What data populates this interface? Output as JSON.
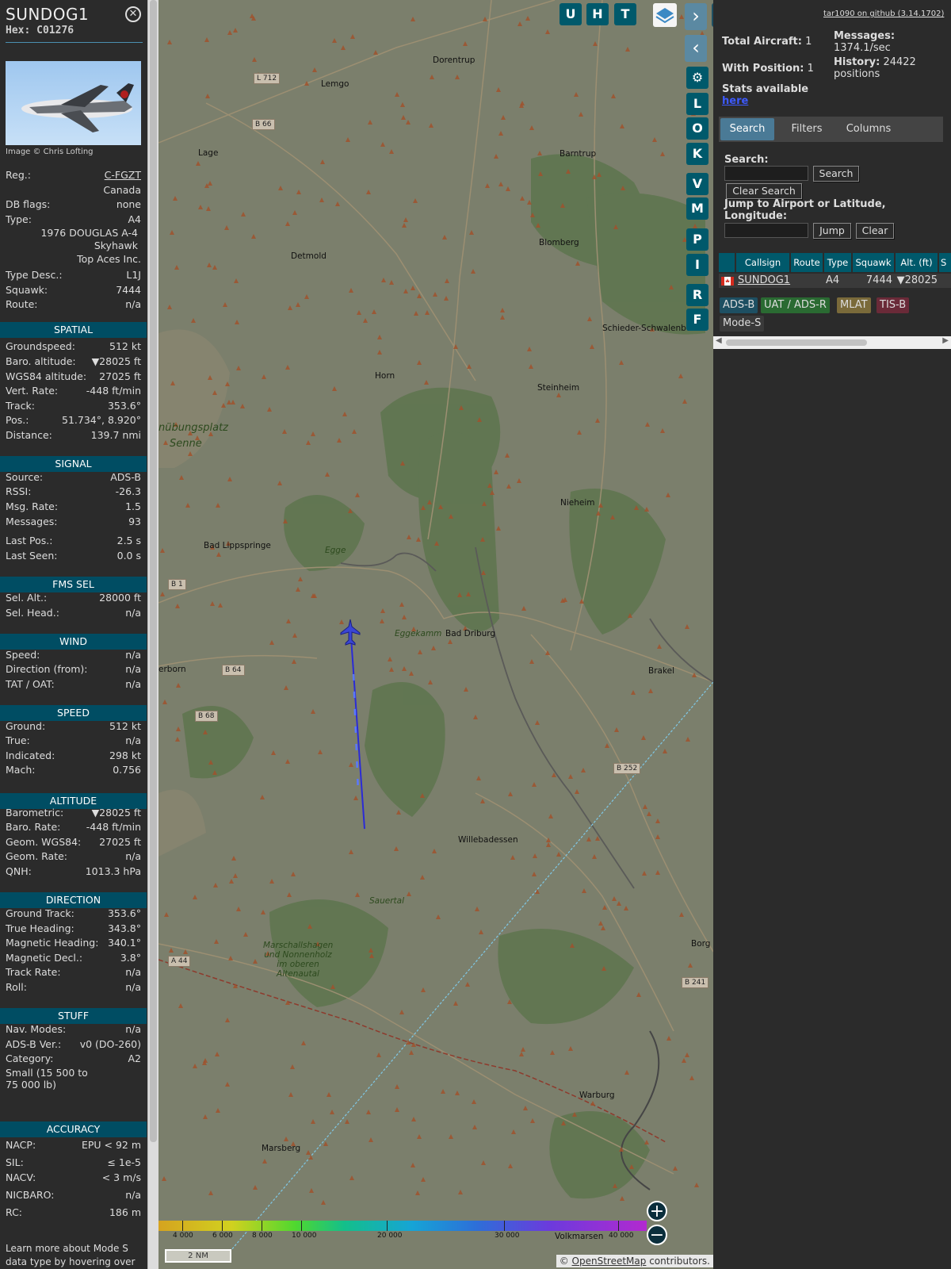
{
  "info": {
    "callsign": "SUNDOG1",
    "hex": "Hex: C01276",
    "close_glyph": "ⓧ",
    "image_credit": "Image © Chris Lofting",
    "rows": [
      {
        "k": "Reg.:",
        "v": "C-FGZT"
      },
      {
        "k": "",
        "v": "Canada"
      },
      {
        "k": "DB flags:",
        "v": "none"
      },
      {
        "k": "Type:",
        "v": "A4"
      }
    ],
    "type_long": "1976 DOUGLAS A-4 Skyhawk",
    "operator": "Top Aces Inc.",
    "rows2": [
      {
        "k": "Type Desc.:",
        "v": "L1J"
      },
      {
        "k": "Squawk:",
        "v": "7444"
      },
      {
        "k": "Route:",
        "v": "n/a"
      }
    ],
    "sections": {
      "spatial": "SPATIAL",
      "signal": "SIGNAL",
      "fms": "FMS SEL",
      "wind": "WIND",
      "speed": "SPEED",
      "altitude": "ALTITUDE",
      "direction": "DIRECTION",
      "stuff": "STUFF",
      "accuracy": "ACCURACY"
    },
    "spatial": [
      {
        "k": "Groundspeed:",
        "v": "512 kt"
      },
      {
        "k": "Baro. altitude:",
        "v": "▼28025 ft"
      },
      {
        "k": "WGS84 altitude:",
        "v": "27025 ft"
      },
      {
        "k": "Vert. Rate:",
        "v": "-448 ft/min"
      },
      {
        "k": "Track:",
        "v": "353.6°"
      },
      {
        "k": "Pos.:",
        "v": "51.734°, 8.920°"
      },
      {
        "k": "Distance:",
        "v": "139.7 nmi"
      }
    ],
    "signal": [
      {
        "k": "Source:",
        "v": "ADS-B"
      },
      {
        "k": "RSSI:",
        "v": "-26.3"
      },
      {
        "k": "Msg. Rate:",
        "v": "1.5"
      },
      {
        "k": "Messages:",
        "v": "93"
      },
      {
        "k": "Last Pos.:",
        "v": "2.5 s"
      },
      {
        "k": "Last Seen:",
        "v": "0.0 s"
      }
    ],
    "fms": [
      {
        "k": "Sel. Alt.:",
        "v": "28000 ft"
      },
      {
        "k": "Sel. Head.:",
        "v": "n/a"
      }
    ],
    "wind": [
      {
        "k": "Speed:",
        "v": "n/a"
      },
      {
        "k": "Direction (from):",
        "v": "n/a"
      },
      {
        "k": "TAT / OAT:",
        "v": "n/a"
      }
    ],
    "speed": [
      {
        "k": "Ground:",
        "v": "512 kt"
      },
      {
        "k": "True:",
        "v": "n/a"
      },
      {
        "k": "Indicated:",
        "v": "298 kt"
      },
      {
        "k": "Mach:",
        "v": "0.756"
      }
    ],
    "altitude": [
      {
        "k": "Barometric:",
        "v": "▼28025 ft"
      },
      {
        "k": "Baro. Rate:",
        "v": "-448 ft/min"
      },
      {
        "k": "Geom. WGS84:",
        "v": "27025 ft"
      },
      {
        "k": "Geom. Rate:",
        "v": "n/a"
      },
      {
        "k": "QNH:",
        "v": "1013.3 hPa"
      }
    ],
    "direction": [
      {
        "k": "Ground Track:",
        "v": "353.6°"
      },
      {
        "k": "True Heading:",
        "v": "343.8°"
      },
      {
        "k": "Magnetic Heading:",
        "v": "340.1°"
      },
      {
        "k": "Magnetic Decl.:",
        "v": "3.8°"
      },
      {
        "k": "Track Rate:",
        "v": "n/a"
      },
      {
        "k": "Roll:",
        "v": "n/a"
      }
    ],
    "stuff": [
      {
        "k": "Nav. Modes:",
        "v": "n/a"
      },
      {
        "k": "ADS-B Ver.:",
        "v": "v0 (DO-260)"
      },
      {
        "k": "Category:",
        "v": "A2"
      }
    ],
    "category_desc": "Small (15 500 to 75 000 lb)",
    "accuracy": [
      {
        "k": "NACP:",
        "v": "EPU < 92 m"
      },
      {
        "k": "SIL:",
        "v": "≤ 1e-5"
      },
      {
        "k": "NACV:",
        "v": "< 3 m/s"
      },
      {
        "k": "NICBARO:",
        "v": "n/a"
      },
      {
        "k": "RC:",
        "v": "186 m"
      }
    ],
    "footer": "Learn more about Mode S data type by hovering over"
  },
  "map": {
    "top_buttons": [
      "U",
      "H",
      "T"
    ],
    "side_buttons": [
      "L",
      "O",
      "K",
      "V",
      "M",
      "P",
      "I",
      "R",
      "F"
    ],
    "places": [
      {
        "n": "Dorentrup",
        "c": false
      },
      {
        "n": "Lemgo",
        "c": false
      },
      {
        "n": "Lage",
        "c": false
      },
      {
        "n": "Barntrup",
        "c": false
      },
      {
        "n": "Detmold",
        "c": false
      },
      {
        "n": "Blomberg",
        "c": false
      },
      {
        "n": "Schieder-Schwalenbo",
        "c": false
      },
      {
        "n": "Horn",
        "c": false
      },
      {
        "n": "Steinheim",
        "c": false
      },
      {
        "n": "nübungsplatz",
        "c": true
      },
      {
        "n": "Senne",
        "c": true
      },
      {
        "n": "Nieheim",
        "c": false
      },
      {
        "n": "Bad Lippspringe",
        "c": false
      },
      {
        "n": "Egge",
        "c": true
      },
      {
        "n": "Eggekamm",
        "c": true
      },
      {
        "n": "Bad Driburg",
        "c": false
      },
      {
        "n": "erborn",
        "c": false
      },
      {
        "n": "Brakel",
        "c": false
      },
      {
        "n": "Willebadessen",
        "c": false
      },
      {
        "n": "Sauertal",
        "c": true
      },
      {
        "n": "Marschallshagen und Nonnenholz im oberen Altenautal",
        "c": true
      },
      {
        "n": "Borg",
        "c": false
      },
      {
        "n": "Warburg",
        "c": false
      },
      {
        "n": "Marsberg",
        "c": false
      },
      {
        "n": "Volkmarsen",
        "c": false
      }
    ],
    "roads": [
      "L 712",
      "B 66",
      "B 1",
      "B 64",
      "B 68",
      "B 252",
      "A 44",
      "B 241"
    ],
    "colorbar_labels": [
      "4 000",
      "6 000",
      "8 000",
      "10 000",
      "20 000",
      "30 000",
      "40 000"
    ],
    "scale": "2 NM",
    "attribution_prefix": "© ",
    "attribution_link": "OpenStreetMap",
    "attribution_suffix": " contributors."
  },
  "panel": {
    "github": "tar1090 on github (3.14.1702)",
    "total_label": "Total Aircraft:",
    "total": "1",
    "pos_label": "With Position:",
    "pos": "1",
    "msgs_label": "Messages:",
    "msgs": "1374.1/sec",
    "hist_label": "History:",
    "hist": "24422 positions",
    "stats_label": "Stats available",
    "stats_link": "here",
    "tabs": [
      "Search",
      "Filters",
      "Columns"
    ],
    "search_label": "Search:",
    "search_btn": "Search",
    "clear_search": "Clear Search",
    "jump_label": "Jump to Airport or Latitude, Longitude:",
    "jump_btn": "Jump",
    "clear_btn": "Clear",
    "columns": [
      "Callsign",
      "Route",
      "Type",
      "Squawk",
      "Alt. (ft)",
      "S"
    ],
    "row": {
      "callsign": "SUNDOG1",
      "route": "",
      "type": "A4",
      "squawk": "7444",
      "alt": "▼28025"
    },
    "tags": [
      "ADS-B",
      "UAT / ADS-R",
      "MLAT",
      "TIS-B",
      "Mode-S"
    ]
  }
}
